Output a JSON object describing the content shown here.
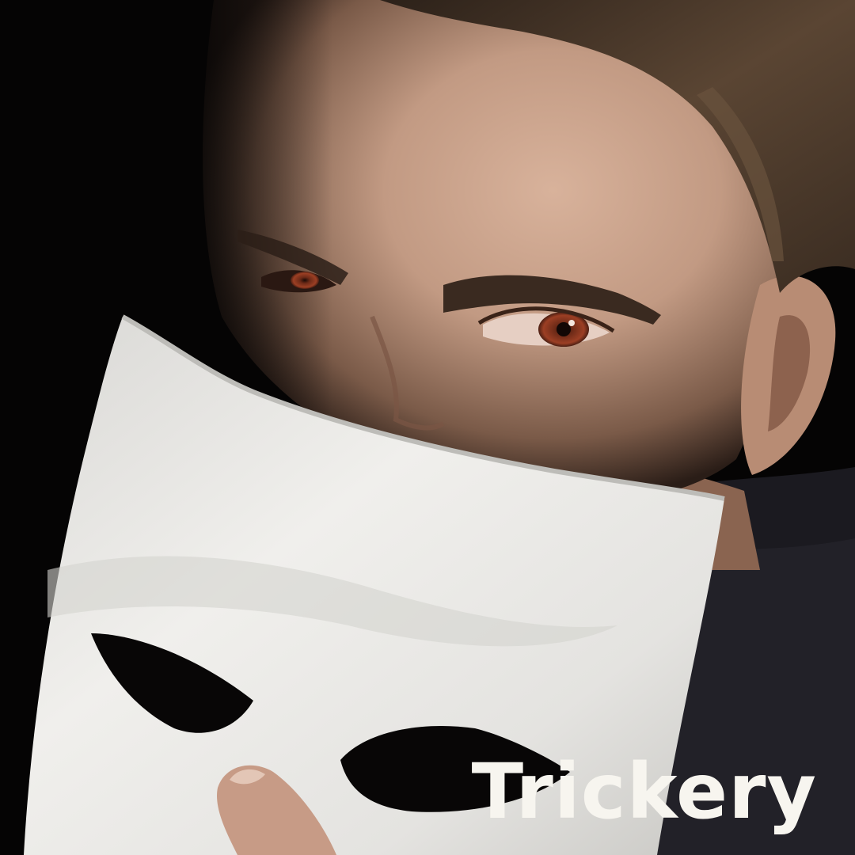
{
  "caption": {
    "text": "Trickery"
  },
  "scene": {
    "background_color": "#050404",
    "skin_color": "#c29a83",
    "hair_color": "#4b3a2c",
    "mask_color": "#ecebe8",
    "iris_color": "#9c3f24",
    "caption_color": "#f7f5ef"
  }
}
